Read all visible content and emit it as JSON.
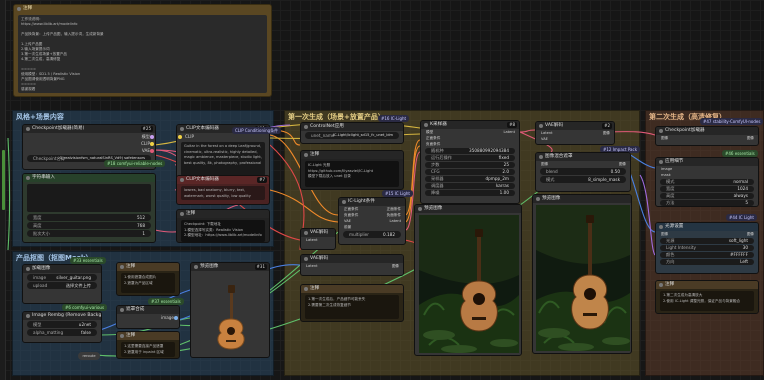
{
  "colors": {
    "canvas": "#161616",
    "group_blue": "#2b4a66",
    "group_green": "#34563f",
    "group_yellow": "#5e522a",
    "group_orange": "#5a3a2a",
    "wire_yellow": "#d6b640",
    "wire_pink": "#e05a78",
    "wire_purple": "#a06be0",
    "wire_green": "#5fbf6a",
    "wire_red": "#e04848",
    "wire_blue": "#4a7fe0",
    "wire_orange": "#f08a2a"
  },
  "top_note": {
    "title": "注释",
    "lines": [
      "工作流说明：",
      "https://www.liblib.art/modelinfo",
      "",
      "产品换背景：上传产品图，输入提示词，生成新背景",
      "",
      "1.上传产品图",
      "2.输入场景提示词",
      "3.第一次生成场景+放置产品",
      "4.第二次生成，高清修复",
      " ",
      "=====",
      "使用模型：SD1.5 / Realistic Vision",
      "产品图请使用透明背景PNG",
      "=====",
      "感谢观看"
    ]
  },
  "groups": {
    "g1": "风格+场景内容",
    "g2": "产品抠图（抠图Mask）",
    "g3": "第一次生成（场景+放置产品）",
    "g4": "第二次生成（高清修复）"
  },
  "nodes": {
    "ckpt": {
      "title": "Checkpoint加载器(简易)",
      "num": "#25",
      "widget_label": "Checkpoint名称",
      "widget_value": "1_realvisionfsm_naturalSinRS_Vd9) safetensors",
      "outputs": [
        "模型",
        "CLIP",
        "VAE"
      ],
      "tag": "#18 comfyui-reliable-nodes"
    },
    "clip_pos": {
      "title": "CLIP文本编码器",
      "num": "#11",
      "input": "CLIP",
      "text": "Guitar in the forest on a deep Leaf/ground, cinematic, ultra-realistic, highly detailed, magic ambience, masterpiece, studio light, best quality, 8k, photography, professional",
      "output": "条件"
    },
    "clip_neg": {
      "title": "CLIP文本编码器",
      "num": "#7",
      "input": "CLIP",
      "text": "lowres, bad anatomy, blurry, text, watermark, worst quality, low quality",
      "output": "条件"
    },
    "empty_latent": {
      "title": "空Latent图像",
      "num": "#5",
      "rows": [
        [
          "宽度",
          "512"
        ],
        [
          "高度",
          "768"
        ],
        [
          "批次大小",
          "1"
        ]
      ]
    },
    "clip_combine": {
      "title": "CLIP Conditioning条件"
    },
    "note_mid": {
      "title": "注释",
      "lines": [
        "1.上传产品图",
        "2.产品图需要使用白色或透明背景",
        "3.可以使用 rembg 去除背景"
      ]
    },
    "note_mid2": {
      "title": "注释",
      "lines": [
        "Checkpoint: 下载地址",
        "1.模型选择写实类：Realistic Vision",
        "2.模型地址：https://www.liblib.art/modelinfo"
      ]
    },
    "load_image": {
      "title": "加载图像",
      "num": "#35",
      "rows": [
        [
          "image",
          "silver_guitar.png"
        ],
        [
          "upload",
          "选择文件上传"
        ]
      ]
    },
    "rmbg": {
      "title": "Image Rembg (Remove Background)",
      "tag": "#36 comfyui-various",
      "rows": [
        [
          "模型",
          "u2net"
        ],
        [
          "alpha_matting",
          "false"
        ]
      ]
    },
    "preview1": {
      "title": "预览图像",
      "num": "#31"
    },
    "mask_note": {
      "title": "注释",
      "lines": [
        "1.使用遮罩合成图片",
        "2.遮罩为产品区域"
      ]
    },
    "mask_note2": {
      "title": "注释",
      "lines": [
        "1.这里需要连接产品遮罩",
        "2.遮罩用于 inpaint 区域"
      ]
    },
    "controlnet": {
      "title": "ControlNet应用",
      "num": "#14",
      "widget_value": "IC-Light/iclight_sd15_fc_unet_ldm",
      "tag": "#16 IC-Light"
    },
    "note_light": {
      "title": "注释",
      "lines": [
        "IC-Light 光照",
        "https://github.com/lllyasviel/IC-Light",
        "模型下载后放入 unet 目录"
      ]
    },
    "iclight_cond": {
      "title": "IC-Light条件",
      "tag": "#15 IC Light",
      "inputs": [
        "正面条件",
        "负面条件",
        "VAE",
        "前景",
        "遮罩"
      ],
      "outputs": [
        "正面条件",
        "负面条件",
        "Latent"
      ],
      "rows": [
        [
          "multiplier",
          "0.182"
        ]
      ]
    },
    "vae_decode1": {
      "title": "VAE解码",
      "inputs": [
        "Latent",
        "VAE"
      ],
      "output": "图像"
    },
    "ksampler1": {
      "title": "K采样器",
      "num": "#8",
      "rows": [
        [
          "随机种",
          "350880992094384"
        ],
        [
          "运行后操作",
          "fixed"
        ],
        [
          "步数",
          "25"
        ],
        [
          "CFG",
          "2.0"
        ],
        [
          "采样器",
          "dpmpp_2m"
        ],
        [
          "调度器",
          "karras"
        ],
        [
          "降噪",
          "1.00"
        ]
      ]
    },
    "preview_big1": {
      "title": "预览图像",
      "num": "#9"
    },
    "vae_decode2": {
      "title": "VAE解码",
      "num": "#2",
      "inputs": [
        "Latent",
        "VAE"
      ],
      "output": "图像"
    },
    "detail_note": {
      "title": "注释",
      "lines": [
        "1.第一次生成后，产品细节可能丢失",
        "2.需要第二次生成恢复细节"
      ]
    },
    "image_blend": {
      "title": "图像混合遮罩",
      "tag": "#12 Impact Pack",
      "rows": [
        [
          "blend",
          "0.50"
        ],
        [
          "模式",
          "8_simple_mask"
        ]
      ]
    },
    "preview_big2": {
      "title": "预览图像"
    },
    "loader2": {
      "title": "Checkpoint加载器",
      "tag": "#47 stability-ComfyUI-nodes"
    },
    "apply_detail": {
      "title": "应用细节",
      "tag": "#46 essentials",
      "inputs": [
        "image",
        "mask"
      ],
      "rows": [
        [
          "sigma",
          "1.00"
        ]
      ]
    },
    "upscale": {
      "title": "图像缩放",
      "tag": "#44 IC Light",
      "rows": [
        [
          "模式",
          "normal"
        ],
        [
          "宽度",
          "1024"
        ],
        [
          "高度",
          "always"
        ],
        [
          "方法",
          "5"
        ]
      ]
    },
    "light_source": {
      "title": "光源设置",
      "rows": [
        [
          "光源",
          "soft_light"
        ],
        [
          "Light Intensity",
          "30"
        ],
        [
          "颜色",
          "#FFFFFF"
        ],
        [
          "方向",
          "Left"
        ]
      ]
    },
    "note_right": {
      "title": "注释",
      "lines": [
        "1.第二次生成为高清放大",
        "2.使用 IC-Light 调整光照，保证产品与背景融合"
      ]
    },
    "bottom_note": {
      "title": "注释",
      "lines": [
        "1.调整产品在画面中的位置",
        "2.调整产品大小以适配场景"
      ]
    },
    "small_tags": [
      "#33 essentials",
      "#37 essentials",
      "#6 comfyui-various",
      "#45 essentials"
    ]
  }
}
